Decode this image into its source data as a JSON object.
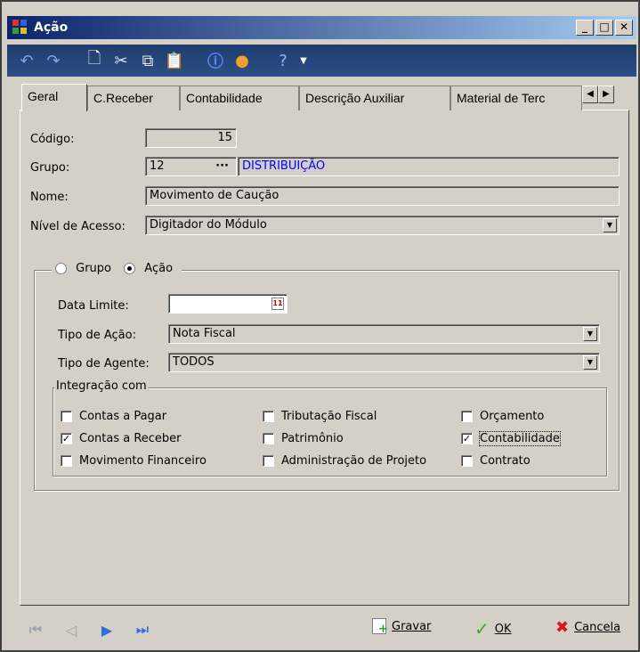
{
  "window": {
    "title": "Ação"
  },
  "tabs": [
    "Geral",
    "C.Receber",
    "Contabilidade",
    "Descrição Auxiliar",
    "Material de Terc"
  ],
  "form": {
    "codigo_label": "Código:",
    "codigo_value": "15",
    "grupo_label": "Grupo:",
    "grupo_code": "12",
    "grupo_ellipsis": "···",
    "grupo_name": "DISTRIBUIÇÃO",
    "nome_label": "Nome:",
    "nome_value": "Movimento de Caução",
    "nivel_label": "Nível de Acesso:",
    "nivel_value": "Digitador do Módulo"
  },
  "radio": {
    "grupo_label": "Grupo",
    "acao_label": "Ação",
    "selected": "Ação"
  },
  "acao": {
    "data_limite_label": "Data Limite:",
    "data_limite_value": "",
    "tipo_acao_label": "Tipo de Ação:",
    "tipo_acao_value": "Nota Fiscal",
    "tipo_agente_label": "Tipo de Agente:",
    "tipo_agente_value": "TODOS"
  },
  "integracao": {
    "title": "Integração com",
    "items": [
      {
        "label": "Contas a Pagar",
        "checked": false
      },
      {
        "label": "Contas a Receber",
        "checked": true
      },
      {
        "label": "Movimento Financeiro",
        "checked": false
      },
      {
        "label": "Tributação Fiscal",
        "checked": false
      },
      {
        "label": "Patrimônio",
        "checked": false
      },
      {
        "label": "Administração de Projeto",
        "checked": false
      },
      {
        "label": "Orçamento",
        "checked": false
      },
      {
        "label": "Contabilidade",
        "checked": true
      },
      {
        "label": "Contrato",
        "checked": false
      }
    ]
  },
  "buttons": {
    "gravar": "Gravar",
    "ok": "OK",
    "cancela": "Cancela"
  },
  "colors": {
    "link_blue": "#0000ff",
    "ok_green": "#3aa820",
    "cancel_red": "#d81818"
  }
}
